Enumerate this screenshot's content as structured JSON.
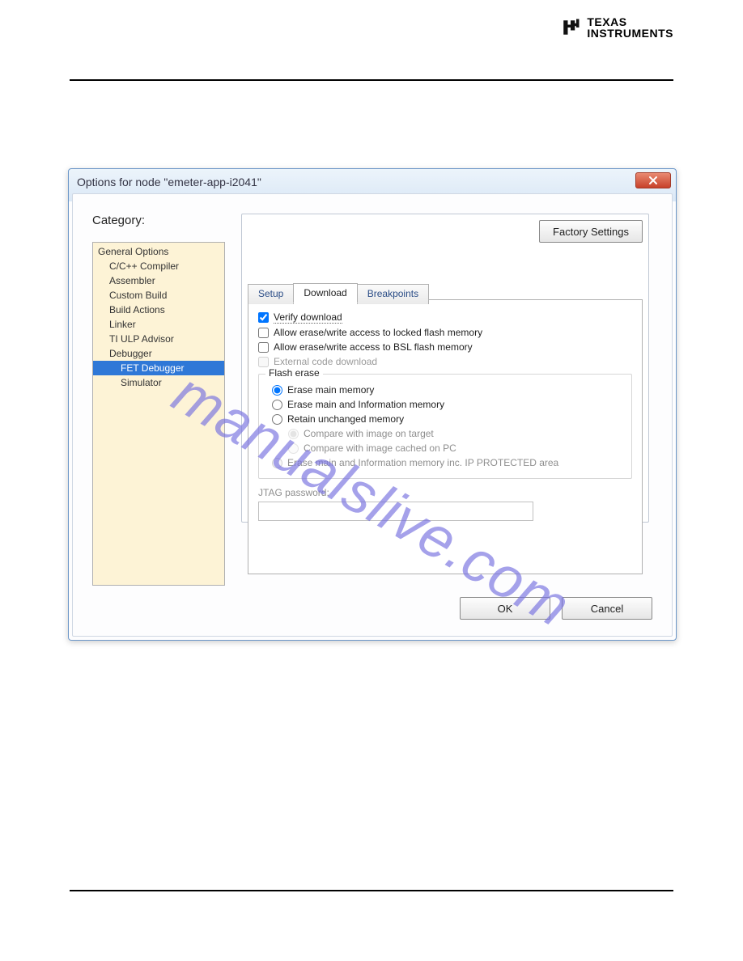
{
  "header": {
    "brand_line1": "TEXAS",
    "brand_line2": "INSTRUMENTS"
  },
  "watermark": "manualslive.com",
  "window": {
    "title": "Options for node \"emeter-app-i2041\"",
    "close_icon": "x",
    "factory_button": "Factory Settings",
    "category_label": "Category:",
    "categories": [
      {
        "label": "General Options",
        "indent": 0
      },
      {
        "label": "C/C++ Compiler",
        "indent": 1
      },
      {
        "label": "Assembler",
        "indent": 1
      },
      {
        "label": "Custom Build",
        "indent": 1
      },
      {
        "label": "Build Actions",
        "indent": 1
      },
      {
        "label": "Linker",
        "indent": 1
      },
      {
        "label": "TI ULP Advisor",
        "indent": 1
      },
      {
        "label": "Debugger",
        "indent": 1
      },
      {
        "label": "FET Debugger",
        "indent": 2,
        "selected": true
      },
      {
        "label": "Simulator",
        "indent": 2
      }
    ],
    "tabs": {
      "setup": "Setup",
      "download": "Download",
      "breakpoints": "Breakpoints",
      "active": "download"
    },
    "download": {
      "verify": "Verify download",
      "allow_locked": "Allow erase/write access to locked flash memory",
      "allow_bsl": "Allow erase/write access to BSL flash memory",
      "external": "External code download",
      "flash_erase_legend": "Flash erase",
      "radios": {
        "erase_main": "Erase main memory",
        "erase_main_info": "Erase main and Information memory",
        "retain": "Retain unchanged memory",
        "cmp_target": "Compare with image on target",
        "cmp_cached": "Compare with image cached on PC",
        "erase_ip": "Erase main and Information memory inc. IP PROTECTED area"
      },
      "jtag_label": "JTAG password:",
      "jtag_value": ""
    },
    "buttons": {
      "ok": "OK",
      "cancel": "Cancel"
    }
  }
}
